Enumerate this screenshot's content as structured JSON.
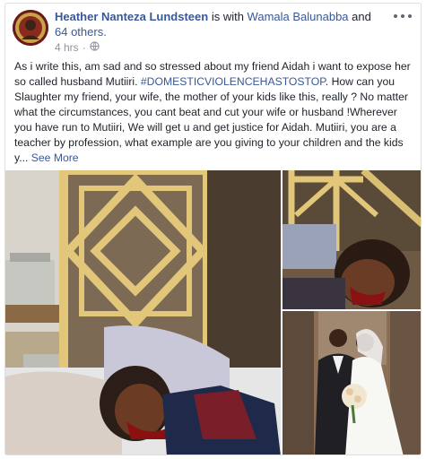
{
  "post": {
    "author": "Heather Nanteza Lundsteen",
    "with_text": " is with ",
    "tagged_person": "Wamala Balunabba",
    "and_text": " and ",
    "others_count": "64 others.",
    "timestamp": "4 hrs",
    "timestamp_separator": "·",
    "privacy_icon": "globe-icon",
    "menu_icon": "more-options-icon",
    "text_before_hashtag": "As i write this, am sad and so stressed about my friend Aidah i want to expose her so called husband Mutiiri. ",
    "hashtag": "#DOMESTICVIOLENCEHASTOSTOP",
    "text_after_hashtag": ". How can you Slaughter my friend, your wife, the mother of your kids like this, really ? No matter what the circumstances, you cant beat and cut your wife or husband !Wherever you have run to Mutiiri, We will get u and get justice for Aidah. Mutiiri, you are a teacher by profession, what example are you giving to your children and the kids y...",
    "see_more": "See More"
  },
  "colors": {
    "link": "#385898",
    "text": "#1d2129",
    "meta": "#90949c",
    "border": "#dddfe2"
  }
}
